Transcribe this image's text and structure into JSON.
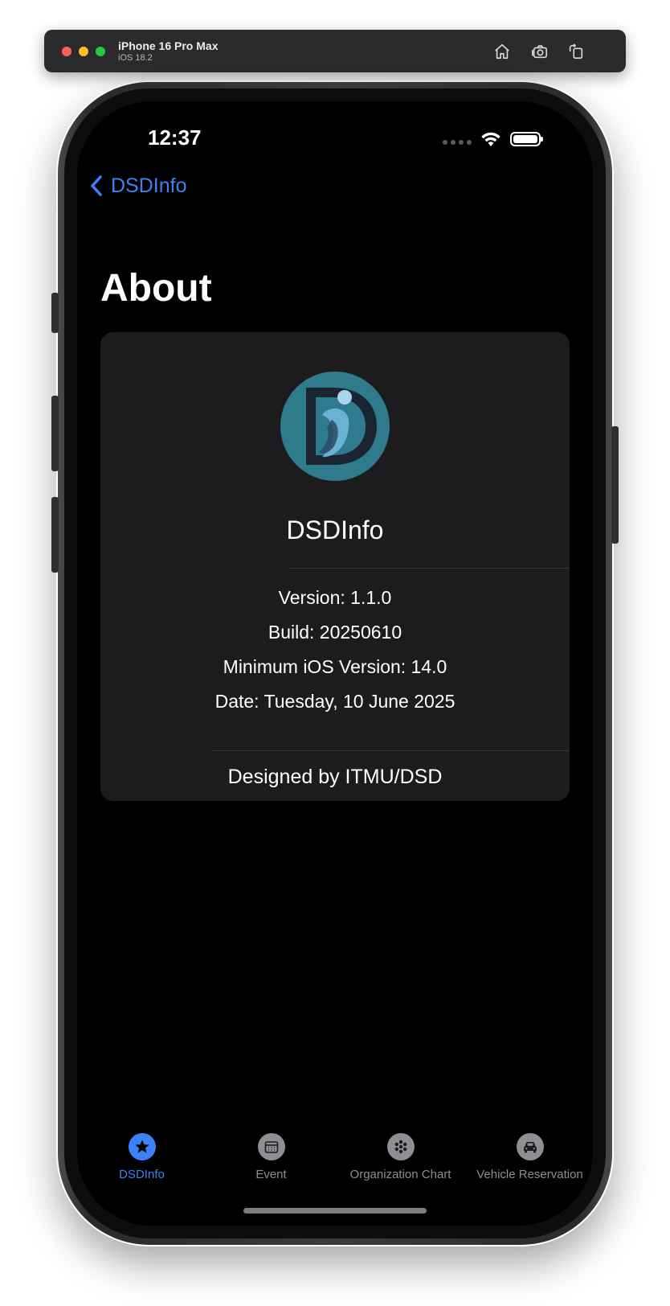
{
  "simulator": {
    "device_name": "iPhone 16 Pro Max",
    "os_version": "iOS 18.2",
    "buttons": [
      "home-icon",
      "screenshot-icon",
      "rotate-icon"
    ]
  },
  "status_bar": {
    "time": "12:37",
    "icons": [
      "signal-dots-icon",
      "wifi-icon",
      "battery-icon"
    ]
  },
  "nav": {
    "back_label": "DSDInfo"
  },
  "page": {
    "title": "About"
  },
  "about_card": {
    "app_name": "DSDInfo",
    "version": "Version: 1.1.0",
    "build": "Build: 20250610",
    "min_ios": "Minimum iOS Version: 14.0",
    "date": "Date: Tuesday, 10 June 2025",
    "designed_by": "Designed by ITMU/DSD"
  },
  "tab_bar": {
    "tabs": [
      {
        "label": "DSDInfo",
        "icon": "star-icon",
        "active": true
      },
      {
        "label": "Event",
        "icon": "calendar-icon",
        "active": false
      },
      {
        "label": "Organization Chart",
        "icon": "org-chart-icon",
        "active": false
      },
      {
        "label": "Vehicle Reservation",
        "icon": "car-icon",
        "active": false
      }
    ]
  },
  "colors": {
    "accent": "#3b82f6",
    "background": "#000000",
    "card": "#1c1c1e",
    "inactive": "#8e8e93",
    "logo_teal": "#2f7b8d"
  }
}
